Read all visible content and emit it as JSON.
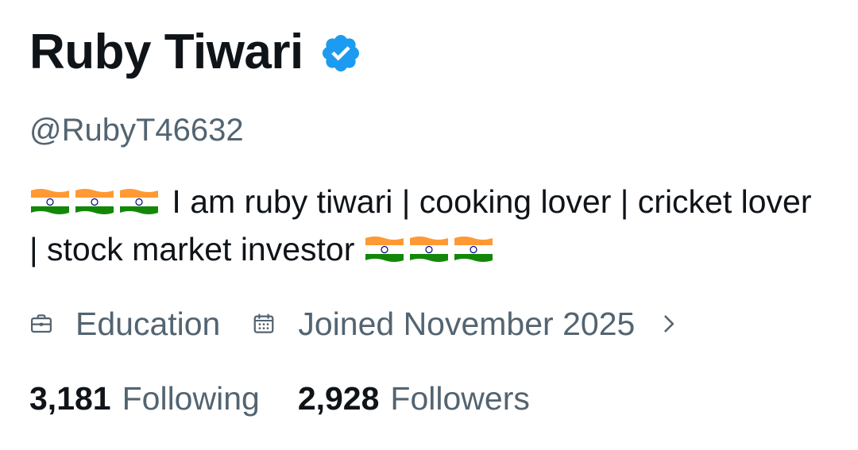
{
  "profile": {
    "display_name": "Ruby Tiwari",
    "verified_icon": "verified-badge-icon",
    "handle": "@RubyT46632",
    "bio_text": "I am ruby tiwari | cooking lover | cricket lover | stock market investor",
    "bio_emoji": "india-flag",
    "bio_emoji_count_start": 3,
    "bio_emoji_count_end": 3
  },
  "meta": {
    "category_icon": "briefcase-icon",
    "category": "Education",
    "joined_icon": "calendar-icon",
    "joined": "Joined November 2025",
    "more_icon": "chevron-right-icon"
  },
  "stats": {
    "following_count": "3,181",
    "following_label": "Following",
    "followers_count": "2,928",
    "followers_label": "Followers"
  },
  "colors": {
    "primary_text": "#0f1419",
    "secondary_text": "#536471",
    "verified_blue": "#1d9bf0"
  }
}
